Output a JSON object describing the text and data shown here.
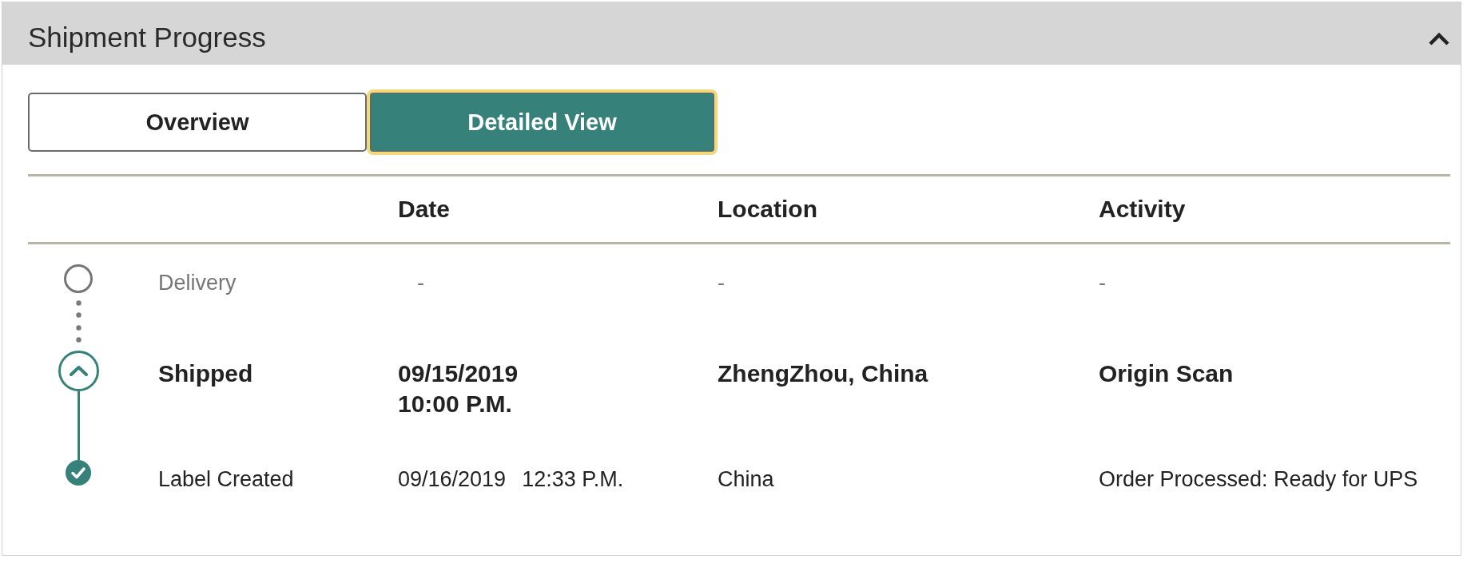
{
  "panel": {
    "title": "Shipment Progress",
    "expanded": true
  },
  "tabs": [
    {
      "label": "Overview",
      "selected": false
    },
    {
      "label": "Detailed View",
      "selected": true
    }
  ],
  "table": {
    "columns": [
      "Date",
      "Location",
      "Activity"
    ],
    "rows": [
      {
        "status": "Delivery",
        "kind": "pending",
        "date": "-",
        "location": "-",
        "activity": "-"
      },
      {
        "status": "Shipped",
        "kind": "current",
        "date": "09/15/2019",
        "time": "10:00 P.M.",
        "location": "ZhengZhou, China",
        "activity": "Origin Scan"
      },
      {
        "status": "Label Created",
        "kind": "done",
        "date": "09/16/2019",
        "time": "12:33 P.M.",
        "location": "China",
        "activity": "Order Processed: Ready for UPS"
      }
    ]
  }
}
